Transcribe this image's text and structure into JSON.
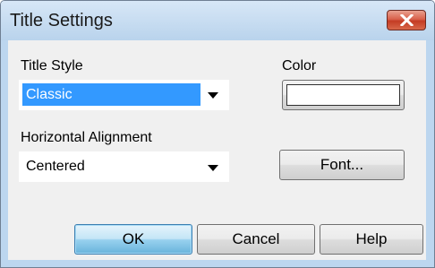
{
  "window": {
    "title": "Title Settings"
  },
  "title_style": {
    "label": "Title Style",
    "selected": "Classic"
  },
  "color": {
    "label": "Color",
    "value": "#ffffff"
  },
  "horizontal_alignment": {
    "label": "Horizontal Alignment",
    "selected": "Centered"
  },
  "buttons": {
    "font": "Font...",
    "ok": "OK",
    "cancel": "Cancel",
    "help": "Help"
  },
  "icons": {
    "close": "close-icon",
    "dropdown": "chevron-down-icon"
  },
  "colors": {
    "selection": "#3399ff",
    "close_button": "#c43c24",
    "default_button": "#98d1ef"
  }
}
